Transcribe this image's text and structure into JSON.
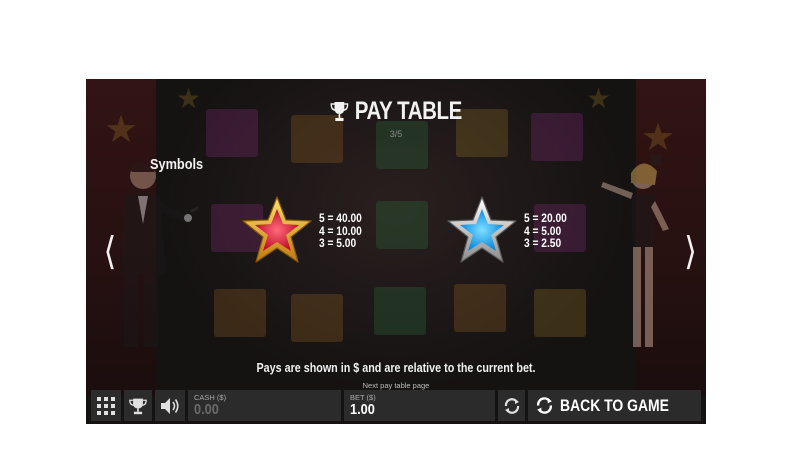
{
  "header": {
    "title": "PAY TABLE",
    "page_indicator": "3/5",
    "icon": "trophy-icon"
  },
  "section": {
    "label": "Symbols"
  },
  "paytable": [
    {
      "symbol": "gold-red-star",
      "colors": {
        "outer": "#f0b020",
        "inner": "#e8223a"
      },
      "pays": [
        "5 = 40.00",
        "4 = 10.00",
        "3 = 5.00"
      ]
    },
    {
      "symbol": "silver-blue-star",
      "colors": {
        "outer": "#d8d8d8",
        "inner": "#18a8f0"
      },
      "pays": [
        "5 = 20.00",
        "4 = 5.00",
        "3 = 2.50"
      ]
    }
  ],
  "navigation": {
    "prev_icon": "chevron-left-icon",
    "next_icon": "chevron-right-icon",
    "prev_glyph": "❬",
    "next_glyph": "❭"
  },
  "footer_note": "Pays are shown in $ and are relative to the current bet.",
  "next_page_link": "Next pay table page",
  "bottom_bar": {
    "menu_icon": "grid-menu-icon",
    "paytable_icon": "trophy-icon",
    "sound_icon": "speaker-icon",
    "cash_label": "CASH ($)",
    "cash_value": "0.00",
    "bet_label": "BET ($)",
    "bet_value": "1.00",
    "autoplay_icon": "refresh-icon",
    "back_label": "BACK TO GAME",
    "back_icon": "refresh-icon"
  },
  "colors": {
    "background": "#151212",
    "bar": "#2b2b2b",
    "text": "#f2f2f2",
    "muted": "#aaaaaa"
  }
}
